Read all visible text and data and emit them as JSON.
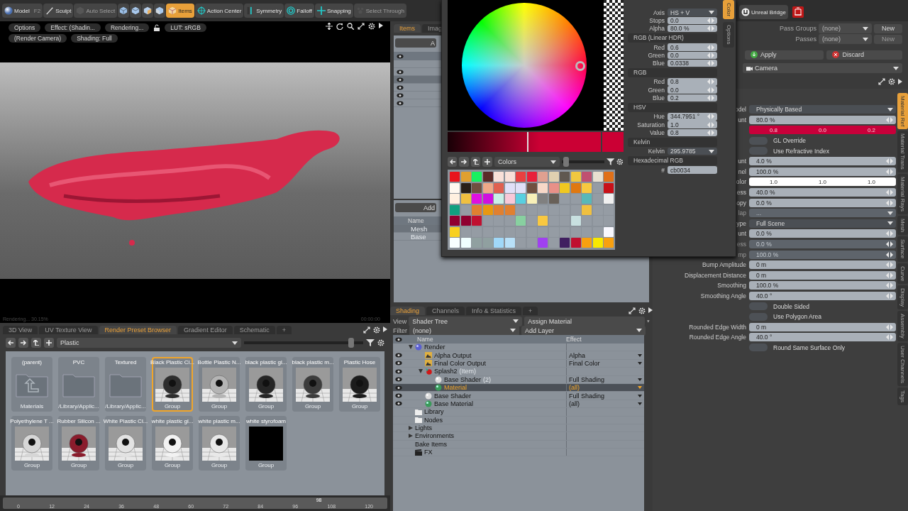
{
  "toolbar": {
    "items": [
      {
        "kind": "text",
        "label": "Model",
        "shortcut": "F2",
        "selected": false,
        "disabled": false
      },
      {
        "kind": "text",
        "label": "Sculpt",
        "selected": false,
        "disabled": false
      },
      {
        "kind": "text",
        "label": "Auto Select",
        "selected": false,
        "disabled": true
      },
      {
        "kind": "icon",
        "selected": false,
        "disabled": false
      },
      {
        "kind": "icon",
        "selected": false,
        "disabled": false
      },
      {
        "kind": "icon",
        "selected": false,
        "disabled": false
      },
      {
        "kind": "icon",
        "selected": false,
        "disabled": false
      },
      {
        "kind": "text",
        "label": "Items",
        "selected": true,
        "disabled": false
      },
      {
        "kind": "text",
        "label": "Action Center",
        "selected": false,
        "disabled": false
      },
      {
        "kind": "text",
        "label": "Symmetry",
        "selected": false,
        "disabled": false
      },
      {
        "kind": "text",
        "label": "Falloff",
        "selected": false,
        "disabled": false
      },
      {
        "kind": "text",
        "label": "Snapping",
        "selected": false,
        "disabled": false
      },
      {
        "kind": "text",
        "label": "Select Through",
        "selected": false,
        "disabled": true
      }
    ],
    "bridge": "Unreal Bridge"
  },
  "viewport": {
    "chips": [
      [
        "Options",
        "Effect: (Shadin...",
        "Rendering...",
        "LUT: sRGB"
      ],
      [
        "(Render Camera)",
        "Shading: Full"
      ]
    ],
    "status": "Rendering... 30.15%",
    "time": "00:00:00"
  },
  "preset_browser": {
    "tabs": [
      {
        "label": "3D View",
        "selected": false
      },
      {
        "label": "UV Texture View",
        "selected": false
      },
      {
        "label": "Render Preset Browser",
        "selected": true
      },
      {
        "label": "Gradient Editor",
        "selected": false
      },
      {
        "label": "Schematic",
        "selected": false
      }
    ],
    "add_tab": "+",
    "path": "Plastic",
    "size_slider": {
      "level": 0.9
    },
    "presets": [
      {
        "kind": "parent",
        "name": "(parent)",
        "sub": "Materials",
        "selected": false
      },
      {
        "kind": "folder",
        "name": "PVC",
        "sub": "/Library/Applic...",
        "selected": false
      },
      {
        "kind": "folder",
        "name": "Textured",
        "sub": "/Library/Applic...",
        "selected": false
      },
      {
        "kind": "preview",
        "name": "Black Plastic Cl...",
        "sub": "Group",
        "selected": true,
        "color": "#2e2e2e"
      },
      {
        "kind": "preview",
        "name": "Bottle Plastic N...",
        "sub": "Group",
        "selected": false,
        "color": "#b4b4b4"
      },
      {
        "kind": "preview",
        "name": "black plastic gl...",
        "sub": "Group",
        "selected": false,
        "color": "#262626"
      },
      {
        "kind": "preview",
        "name": "black plastic m...",
        "sub": "Group",
        "selected": false,
        "color": "#3c3c3c"
      },
      {
        "kind": "preview",
        "name": "Plastic Hose",
        "sub": "Group",
        "selected": false,
        "color": "#1c1c1c"
      },
      {
        "kind": "preview",
        "name": "Polyethylene T ...",
        "sub": "Group",
        "selected": false,
        "color": "#d6d6d6"
      },
      {
        "kind": "preview",
        "name": "Rubber Silicon ...",
        "sub": "Group",
        "selected": false,
        "color": "#8a1c2c"
      },
      {
        "kind": "preview",
        "name": "White Plastic Cl...",
        "sub": "Group",
        "selected": false,
        "color": "#e2e2e2"
      },
      {
        "kind": "preview",
        "name": "white plastic gl...",
        "sub": "Group",
        "selected": false,
        "color": "#f2f2f2"
      },
      {
        "kind": "preview",
        "name": "white plastic m...",
        "sub": "Group",
        "selected": false,
        "color": "#e8e8e8"
      },
      {
        "kind": "blank",
        "name": "white styrofoam",
        "sub": "Group",
        "selected": false
      }
    ]
  },
  "timeline": {
    "ticks": [
      "0",
      "12",
      "24",
      "36",
      "48",
      "60",
      "72",
      "84",
      "96",
      "108",
      "120"
    ],
    "current": "98",
    "level": 0.815
  },
  "items_panel": {
    "tabs": [
      {
        "label": "Items",
        "selected": true
      },
      {
        "label": "Imag",
        "selected": false
      }
    ],
    "button": "A",
    "rows": [
      {
        "visible": false,
        "selected": false
      },
      {
        "visible": true,
        "selected": false
      },
      {
        "visible": true,
        "selected": true
      },
      {
        "visible": true,
        "selected": false
      },
      {
        "visible": true,
        "selected": false
      },
      {
        "visible": true,
        "selected": false
      }
    ],
    "add_button": "Add",
    "name_header": "Name",
    "tree": [
      {
        "label": "Mesh",
        "selected": true
      },
      {
        "label": "Base",
        "selected": false
      }
    ]
  },
  "shading": {
    "tabs": [
      {
        "label": "Shading",
        "selected": true
      },
      {
        "label": "Channels",
        "selected": false
      },
      {
        "label": "Info & Statistics",
        "selected": false
      }
    ],
    "add_tab": "+",
    "view_label": "View",
    "view": "Shader Tree",
    "assign": "Assign Material",
    "filter_label": "Filter",
    "filter": "(none)",
    "add_layer": "Add Layer",
    "columns": [
      "Name",
      "Effect"
    ],
    "tree": [
      {
        "kind": "render",
        "label": "Render",
        "expanded": true,
        "visible": false,
        "selected": false,
        "children": [
          {
            "kind": "output",
            "label": "Alpha Output",
            "effect": "Alpha",
            "visible": true,
            "selected": false
          },
          {
            "kind": "output",
            "label": "Final Color Output",
            "effect": "Final Color",
            "visible": true,
            "selected": false
          },
          {
            "kind": "item",
            "label": "Splash2",
            "note": "(Item)",
            "expanded": true,
            "visible": true,
            "selected": false,
            "children": [
              {
                "kind": "shader",
                "label": "Base Shader",
                "note": "(2)",
                "effect": "Full Shading",
                "visible": true,
                "selected": false
              },
              {
                "kind": "material",
                "label": "Material",
                "effect": "(all)",
                "visible": true,
                "selected": true
              }
            ]
          },
          {
            "kind": "shader",
            "label": "Base Shader",
            "effect": "Full Shading",
            "visible": true,
            "selected": false
          },
          {
            "kind": "material",
            "label": "Base Material",
            "effect": "(all)",
            "visible": true,
            "selected": false
          }
        ]
      },
      {
        "kind": "folder",
        "label": "Library",
        "visible": false,
        "selected": false
      },
      {
        "kind": "folder",
        "label": "Nodes",
        "visible": false,
        "selected": false
      },
      {
        "kind": "group",
        "label": "Lights",
        "expanded": false,
        "visible": false,
        "selected": false
      },
      {
        "kind": "group",
        "label": "Environments",
        "expanded": false,
        "visible": false,
        "selected": false
      },
      {
        "kind": "plain",
        "label": "Bake Items",
        "visible": false,
        "selected": false
      },
      {
        "kind": "fx",
        "label": "FX",
        "visible": false,
        "selected": false
      }
    ]
  },
  "color_editor": {
    "tabs": [
      {
        "label": "Color",
        "selected": true
      },
      {
        "label": "Options",
        "selected": false
      }
    ],
    "top_fields": [
      {
        "kind": "dropdown",
        "label": "Axis",
        "value": "HS + V"
      },
      {
        "kind": "number",
        "label": "Stops",
        "value": "0.0"
      },
      {
        "kind": "number",
        "label": "Alpha",
        "value": "80.0 %"
      }
    ],
    "sections": [
      {
        "title": "RGB (Linear HDR)",
        "fields": [
          {
            "kind": "number",
            "label": "Red",
            "value": "0.6"
          },
          {
            "kind": "number",
            "label": "Green",
            "value": "0.0"
          },
          {
            "kind": "number",
            "label": "Blue",
            "value": "0.0338"
          }
        ]
      },
      {
        "title": "RGB",
        "fields": [
          {
            "kind": "number",
            "label": "Red",
            "value": "0.8"
          },
          {
            "kind": "number",
            "label": "Green",
            "value": "0.0"
          },
          {
            "kind": "number",
            "label": "Blue",
            "value": "0.2"
          }
        ]
      },
      {
        "title": "HSV",
        "fields": [
          {
            "kind": "number",
            "label": "Hue",
            "value": "344.7951 °"
          },
          {
            "kind": "number",
            "label": "Saturation",
            "value": "1.0"
          },
          {
            "kind": "number",
            "label": "Value",
            "value": "0.8"
          }
        ]
      },
      {
        "title": "Kelvin",
        "fields": [
          {
            "kind": "dropdown",
            "label": "Kelvin",
            "value": "295.9785"
          }
        ]
      },
      {
        "title": "Hexadecimal RGB",
        "fields": [
          {
            "kind": "text",
            "label": "#",
            "value": "cb0034"
          }
        ]
      }
    ],
    "palette_name": "Colors",
    "palette_slider": {
      "level": 0.1
    },
    "swatches": [
      {
        "cells": [
          {
            "kind": "swatch",
            "color": "#e8141c"
          },
          {
            "kind": "swatch",
            "color": "#e0a030"
          },
          {
            "kind": "swatch",
            "color": "#18f060"
          },
          {
            "kind": "swatch",
            "color": "#5a2a28"
          },
          {
            "kind": "swatch",
            "color": "#f8e0d8"
          },
          {
            "kind": "swatch",
            "color": "#f8e0d8"
          },
          {
            "kind": "swatch",
            "color": "#e84040"
          },
          {
            "kind": "swatch",
            "color": "#e8203a"
          },
          {
            "kind": "swatch",
            "color": "#e0a090"
          },
          {
            "kind": "swatch",
            "color": "#e0d0b0"
          },
          {
            "kind": "swatch",
            "color": "#605850"
          },
          {
            "kind": "swatch",
            "color": "#f0c840"
          },
          {
            "kind": "swatch",
            "color": "#c05070"
          },
          {
            "kind": "swatch",
            "color": "#e8e0d0"
          },
          {
            "kind": "swatch",
            "color": "#e07018"
          }
        ]
      },
      {
        "cells": [
          {
            "kind": "swatch",
            "color": "#fff8f0"
          },
          {
            "kind": "swatch",
            "color": "#282018"
          },
          {
            "kind": "swatch",
            "color": "#705040"
          },
          {
            "kind": "swatch",
            "color": "#f0a888"
          },
          {
            "kind": "swatch",
            "color": "#e06050"
          },
          {
            "kind": "swatch",
            "color": "#e0e0f8"
          },
          {
            "kind": "swatch",
            "color": "#e0e0f8"
          },
          {
            "kind": "swatch",
            "color": "#705040"
          },
          {
            "kind": "swatch",
            "color": "#f8d8c8"
          },
          {
            "kind": "swatch",
            "color": "#e89088"
          },
          {
            "kind": "swatch",
            "color": "#f0c820"
          },
          {
            "kind": "swatch",
            "color": "#e07810"
          },
          {
            "kind": "swatch",
            "color": "#f8c840"
          },
          {
            "kind": "empty"
          },
          {
            "kind": "swatch",
            "color": "#c81018"
          }
        ]
      },
      {
        "cells": [
          {
            "kind": "swatch",
            "color": "#fff0e0"
          },
          {
            "kind": "swatch",
            "color": "#f0c040"
          },
          {
            "kind": "swatch",
            "color": "#e010e0"
          },
          {
            "kind": "swatch",
            "color": "#d010e0"
          },
          {
            "kind": "swatch",
            "color": "#c8f0e8"
          },
          {
            "kind": "swatch",
            "color": "#f8c8d8"
          },
          {
            "kind": "swatch",
            "color": "#58d0e0"
          },
          {
            "kind": "swatch",
            "color": "#f8f0b8"
          },
          {
            "kind": "swatch",
            "color": "#808080"
          },
          {
            "kind": "swatch",
            "color": "#686058"
          },
          {
            "kind": "empty"
          },
          {
            "kind": "empty"
          },
          {
            "kind": "swatch",
            "color": "#58b8b8"
          },
          {
            "kind": "empty"
          },
          {
            "kind": "swatch",
            "color": "#f0f0f0"
          }
        ]
      },
      {
        "cells": [
          {
            "kind": "swatch",
            "color": "#10a080"
          },
          {
            "kind": "empty"
          },
          {
            "kind": "swatch",
            "color": "#e08030"
          },
          {
            "kind": "swatch",
            "color": "#e89810"
          },
          {
            "kind": "swatch",
            "color": "#e08030"
          },
          {
            "kind": "swatch",
            "color": "#e08030"
          },
          {
            "kind": "empty"
          },
          {
            "kind": "empty"
          },
          {
            "kind": "empty"
          },
          {
            "kind": "empty"
          },
          {
            "kind": "empty"
          },
          {
            "kind": "empty"
          },
          {
            "kind": "swatch",
            "color": "#f0c040"
          },
          {
            "kind": "empty"
          },
          {
            "kind": "empty"
          }
        ]
      },
      {
        "cells": [
          {
            "kind": "swatch",
            "color": "#900030"
          },
          {
            "kind": "swatch",
            "color": "#900030"
          },
          {
            "kind": "swatch",
            "color": "#c01030"
          },
          {
            "kind": "empty"
          },
          {
            "kind": "empty"
          },
          {
            "kind": "empty"
          },
          {
            "kind": "swatch",
            "color": "#88d0a0"
          },
          {
            "kind": "empty"
          },
          {
            "kind": "swatch",
            "color": "#f8c840"
          },
          {
            "kind": "empty"
          },
          {
            "kind": "empty"
          },
          {
            "kind": "swatch",
            "color": "#c8e0e0"
          },
          {
            "kind": "empty"
          },
          {
            "kind": "empty"
          },
          {
            "kind": "empty"
          }
        ]
      },
      {
        "cells": [
          {
            "kind": "swatch",
            "color": "#f8d020"
          },
          {
            "kind": "empty"
          },
          {
            "kind": "empty"
          },
          {
            "kind": "empty"
          },
          {
            "kind": "empty"
          },
          {
            "kind": "empty"
          },
          {
            "kind": "empty"
          },
          {
            "kind": "empty"
          },
          {
            "kind": "empty"
          },
          {
            "kind": "empty"
          },
          {
            "kind": "empty"
          },
          {
            "kind": "empty"
          },
          {
            "kind": "empty"
          },
          {
            "kind": "empty"
          },
          {
            "kind": "swatch",
            "color": "#f8f8ff"
          }
        ]
      },
      {
        "cells": [
          {
            "kind": "swatch",
            "color": "#f8ffff"
          },
          {
            "kind": "swatch",
            "color": "#f0ffff"
          },
          {
            "kind": "swatch",
            "color": "#90a0a0"
          },
          {
            "kind": "swatch",
            "color": "#90a0a0"
          },
          {
            "kind": "swatch",
            "color": "#a0d8f8"
          },
          {
            "kind": "swatch",
            "color": "#b8e0f8"
          },
          {
            "kind": "empty"
          },
          {
            "kind": "empty"
          },
          {
            "kind": "swatch",
            "color": "#a040f0"
          },
          {
            "kind": "empty"
          },
          {
            "kind": "swatch",
            "color": "#402060"
          },
          {
            "kind": "swatch",
            "color": "#c01030"
          },
          {
            "kind": "swatch",
            "color": "#f8a010"
          },
          {
            "kind": "swatch",
            "color": "#f8e800"
          },
          {
            "kind": "swatch",
            "color": "#f8a010"
          }
        ]
      }
    ]
  },
  "render_panel": {
    "pass_groups": {
      "label": "Pass Groups",
      "value": "(none)",
      "button": "New",
      "disabled": false
    },
    "passes": {
      "label": "Passes",
      "value": "(none)",
      "button": "New",
      "disabled": true
    },
    "apply": "Apply",
    "discard": "Discard",
    "camera": "Camera"
  },
  "properties": {
    "tabs": [
      {
        "label": "Material Ref",
        "selected": true
      },
      {
        "label": "Material Trans",
        "selected": false
      },
      {
        "label": "Material Rays",
        "selected": false
      },
      {
        "label": "Mesh",
        "selected": false
      },
      {
        "label": "Surface",
        "selected": false
      },
      {
        "label": "Curve",
        "selected": false
      },
      {
        "label": "Display",
        "selected": false
      },
      {
        "label": "Assembly",
        "selected": false
      },
      {
        "label": "User Channels",
        "selected": false
      },
      {
        "label": "Tags",
        "selected": false
      }
    ],
    "rows": [
      {
        "kind": "dropdown",
        "label": "odel",
        "value": "Physically Based",
        "disabled": false
      },
      {
        "kind": "number",
        "label": "unt",
        "value": "80.0 %",
        "disabled": false
      },
      {
        "kind": "color",
        "values": [
          "0.8",
          "0.0",
          "0.2"
        ],
        "color": "#c8003a",
        "disabled": false
      },
      {
        "kind": "toggle",
        "value": "GL Override",
        "disabled": false
      },
      {
        "kind": "toggle",
        "value": "Use Refractive Index",
        "disabled": false
      },
      {
        "kind": "number",
        "label": "unt",
        "value": "4.0 %",
        "disabled": false
      },
      {
        "kind": "number",
        "label": "nel",
        "value": "100.0 %",
        "disabled": false
      },
      {
        "kind": "color",
        "label": "olor",
        "values": [
          "1.0",
          "1.0",
          "1.0"
        ],
        "color": "#ffffff",
        "disabled": false
      },
      {
        "kind": "number",
        "label": "ess",
        "value": "40.0 %",
        "disabled": false
      },
      {
        "kind": "number",
        "label": "opy",
        "value": "0.0 %",
        "disabled": false
      },
      {
        "kind": "dropdown",
        "label": "lap",
        "value": "...",
        "disabled": true
      },
      {
        "kind": "dropdown",
        "label": "ype",
        "value": "Full Scene",
        "disabled": false
      },
      {
        "kind": "number",
        "label": "unt",
        "value": "0.0 %",
        "disabled": false
      },
      {
        "kind": "number",
        "label": "ess",
        "value": "0.0 %",
        "disabled": true
      },
      {
        "kind": "number",
        "label": "mp",
        "value": "100.0 %",
        "disabled": true
      },
      {
        "kind": "number",
        "label": "Bump Amplitude",
        "value": "0 m",
        "disabled": false
      },
      {
        "kind": "number",
        "label": "Displacement Distance",
        "value": "0 m",
        "disabled": false
      },
      {
        "kind": "number",
        "label": "Smoothing",
        "value": "100.0 %",
        "disabled": false
      },
      {
        "kind": "number",
        "label": "Smoothing Angle",
        "value": "40.0 °",
        "disabled": false
      },
      {
        "kind": "toggle",
        "value": "Double Sided",
        "disabled": false
      },
      {
        "kind": "toggle",
        "value": "Use Polygon Area",
        "disabled": false
      },
      {
        "kind": "number",
        "label": "Rounded Edge Width",
        "value": "0 m",
        "disabled": false
      },
      {
        "kind": "number",
        "label": "Rounded Edge Angle",
        "value": "40.0 °",
        "disabled": false
      },
      {
        "kind": "toggle",
        "value": "Round Same Surface Only",
        "disabled": false
      }
    ]
  }
}
